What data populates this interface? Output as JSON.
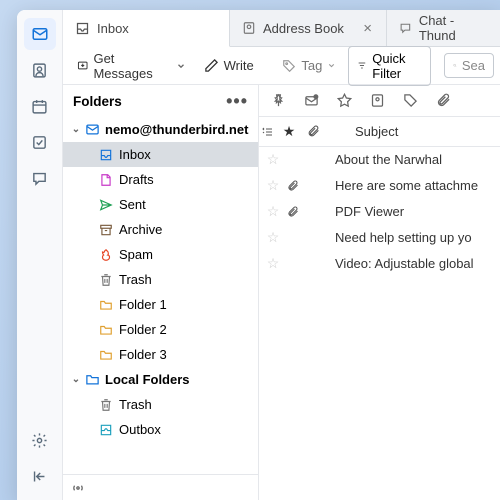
{
  "spaces": {
    "settings": "Settings",
    "collapse": "Collapse"
  },
  "tabs": [
    {
      "label": "Inbox",
      "active": true
    },
    {
      "label": "Address Book",
      "active": false,
      "closable": true
    },
    {
      "label": "Chat - Thund",
      "active": false
    }
  ],
  "toolbar": {
    "get_messages": "Get Messages",
    "write": "Write",
    "tag": "Tag",
    "quick_filter": "Quick Filter",
    "search_placeholder": "Sea"
  },
  "folder_pane": {
    "header": "Folders",
    "accounts": [
      {
        "name": "nemo@thunderbird.net",
        "folders": [
          {
            "name": "Inbox",
            "icon": "inbox",
            "selected": true
          },
          {
            "name": "Drafts",
            "icon": "drafts"
          },
          {
            "name": "Sent",
            "icon": "sent"
          },
          {
            "name": "Archive",
            "icon": "archive"
          },
          {
            "name": "Spam",
            "icon": "spam"
          },
          {
            "name": "Trash",
            "icon": "trash"
          },
          {
            "name": "Folder 1",
            "icon": "folder"
          },
          {
            "name": "Folder 2",
            "icon": "folder"
          },
          {
            "name": "Folder 3",
            "icon": "folder"
          }
        ]
      },
      {
        "name": "Local Folders",
        "folders": [
          {
            "name": "Trash",
            "icon": "trash"
          },
          {
            "name": "Outbox",
            "icon": "outbox"
          }
        ]
      }
    ]
  },
  "columns": {
    "subject": "Subject"
  },
  "messages": [
    {
      "subject": "About the Narwhal",
      "attachment": false
    },
    {
      "subject": "Here are some attachme",
      "attachment": true
    },
    {
      "subject": "PDF Viewer",
      "attachment": true
    },
    {
      "subject": "Need help setting up yo",
      "attachment": false
    },
    {
      "subject": "Video: Adjustable global",
      "attachment": false
    }
  ]
}
